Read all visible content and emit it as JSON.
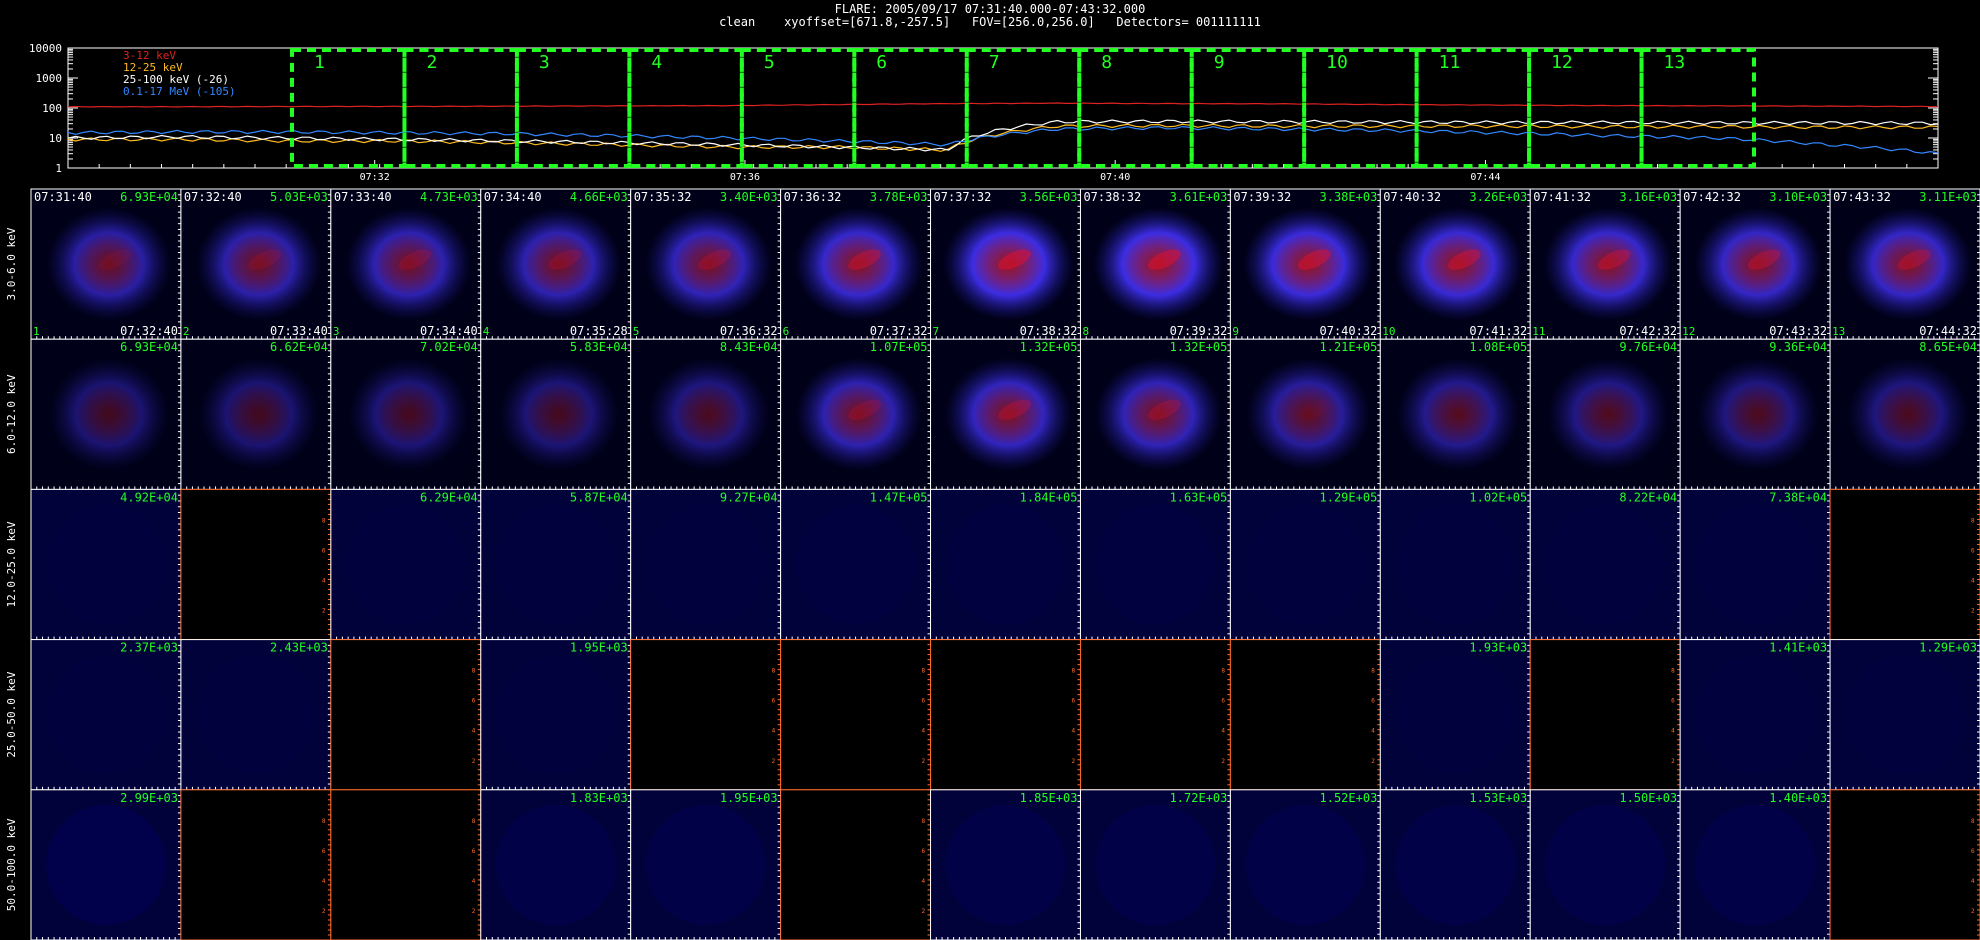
{
  "header": {
    "line1": "FLARE: 2005/09/17 07:31:40.000-07:43:32.000",
    "line2": "clean    xyoffset=[671.8,-257.5]   FOV=[256.0,256.0]   Detectors= 001111111"
  },
  "colors": {
    "bg": "#000000",
    "green": "#22ff22",
    "orange_axis": "#ff6a2a",
    "curve_3_12": "#dd2222",
    "curve_12_25": "#ffbb22",
    "curve_25_100": "#ffffff",
    "curve_01_17": "#3388ff"
  },
  "chart_data": [
    {
      "type": "line",
      "title": "",
      "xlabel": "",
      "ylabel": "",
      "yscale": "log",
      "ylim": [
        1,
        10000
      ],
      "ytick_labels": [
        "10000",
        "1000",
        "100",
        "10",
        "1"
      ],
      "xtick_labels": [
        "07:32",
        "07:36",
        "07:40",
        "07:44"
      ],
      "legend_placement": "top-left",
      "series": [
        {
          "name": "3-12 keV",
          "color": "#dd2222",
          "approx_values": [
            110,
            110,
            112,
            113,
            115,
            118,
            120,
            130,
            140,
            145,
            140,
            138,
            130,
            125,
            120,
            118,
            115,
            112
          ]
        },
        {
          "name": "12-25 keV",
          "color": "#ffbb22",
          "approx_values": [
            9,
            9,
            8,
            8,
            7,
            6,
            5,
            5,
            4,
            25,
            26,
            25,
            25,
            25,
            24,
            24,
            23,
            23
          ]
        },
        {
          "name": "25-100 keV (-26)",
          "color": "#ffffff",
          "approx_values": [
            10,
            11,
            10,
            9,
            8,
            7,
            6,
            5,
            4,
            35,
            36,
            35,
            34,
            33,
            33,
            32,
            32,
            31
          ]
        },
        {
          "name": "0.1-17 MeV (-105)",
          "color": "#3388ff",
          "approx_values": [
            15,
            16,
            16,
            15,
            14,
            12,
            10,
            8,
            6,
            20,
            22,
            20,
            18,
            15,
            12,
            10,
            6,
            3
          ]
        }
      ],
      "intervals": [
        "1",
        "2",
        "3",
        "4",
        "5",
        "6",
        "7",
        "8",
        "9",
        "10",
        "11",
        "12",
        "13"
      ]
    },
    {
      "type": "heatmap",
      "title": "",
      "columns": 13,
      "rows": [
        "3.0-6.0 keV",
        "6.0-12.0 keV",
        "12.0-25.0 keV",
        "25.0-50.0 keV",
        "50.0-100.0 keV"
      ],
      "start_times": [
        "07:31:40",
        "07:32:40",
        "07:33:40",
        "07:34:40",
        "07:35:32",
        "07:36:32",
        "07:37:32",
        "07:38:32",
        "07:39:32",
        "07:40:32",
        "07:41:32",
        "07:42:32",
        "07:43:32"
      ],
      "end_times": [
        "07:32:40",
        "07:33:40",
        "07:34:40",
        "07:35:28",
        "07:36:32",
        "07:37:32",
        "07:38:32",
        "07:39:32",
        "07:40:32",
        "07:41:32",
        "07:42:32",
        "07:43:32",
        "07:44:32"
      ],
      "interval_numbers": [
        "1",
        "2",
        "3",
        "4",
        "5",
        "6",
        "7",
        "8",
        "9",
        "10",
        "11",
        "12",
        "13"
      ],
      "peak_labels": [
        [
          "6.93E+04",
          "5.03E+03",
          "4.73E+03",
          "4.66E+03",
          "3.40E+03",
          "3.78E+03",
          "3.56E+03",
          "3.61E+03",
          "3.38E+03",
          "3.26E+03",
          "3.16E+03",
          "3.10E+03",
          "3.11E+03"
        ],
        [
          "6.93E+04",
          "6.62E+04",
          "7.02E+04",
          "5.83E+04",
          "8.43E+04",
          "1.07E+05",
          "1.32E+05",
          "1.32E+05",
          "1.21E+05",
          "1.08E+05",
          "9.76E+04",
          "9.36E+04",
          "8.65E+04"
        ],
        [
          "4.92E+04",
          "",
          "6.29E+04",
          "5.87E+04",
          "9.27E+04",
          "1.47E+05",
          "1.84E+05",
          "1.63E+05",
          "1.29E+05",
          "1.02E+05",
          "8.22E+04",
          "7.38E+04",
          ""
        ],
        [
          "2.37E+03",
          "2.43E+03",
          "",
          "1.95E+03",
          "",
          "",
          "",
          "",
          "",
          "1.93E+03",
          "",
          "1.41E+03",
          "1.29E+03"
        ],
        [
          "2.99E+03",
          "",
          "",
          "1.83E+03",
          "1.95E+03",
          "",
          "1.85E+03",
          "1.72E+03",
          "1.52E+03",
          "1.53E+03",
          "1.50E+03",
          "1.40E+03",
          ""
        ]
      ],
      "cell_levels": [
        [
          0.45,
          0.5,
          0.55,
          0.55,
          0.6,
          0.75,
          0.9,
          0.9,
          0.85,
          0.8,
          0.75,
          0.7,
          0.7
        ],
        [
          0.12,
          0.12,
          0.14,
          0.15,
          0.2,
          0.55,
          0.65,
          0.6,
          0.4,
          0.3,
          0.25,
          0.22,
          0.2
        ],
        [
          0.02,
          0,
          0.02,
          0.02,
          0.02,
          0.03,
          0.03,
          0.03,
          0.02,
          0.02,
          0.02,
          0.02,
          0
        ],
        [
          0.02,
          0.02,
          0,
          0.02,
          0,
          0,
          0,
          0,
          0,
          0.02,
          0,
          0.02,
          0.02
        ],
        [
          0.08,
          0,
          0,
          0.06,
          0.06,
          0,
          0.06,
          0.06,
          0.06,
          0.06,
          0.06,
          0.06,
          0
        ]
      ],
      "empty_panels": [
        [],
        [],
        [
          1,
          12
        ],
        [
          2,
          4,
          5,
          6,
          7,
          8,
          10
        ],
        [
          1,
          2,
          5,
          12
        ]
      ],
      "empty_panel_ticks": [
        "2",
        "4",
        "6",
        "8"
      ]
    }
  ]
}
